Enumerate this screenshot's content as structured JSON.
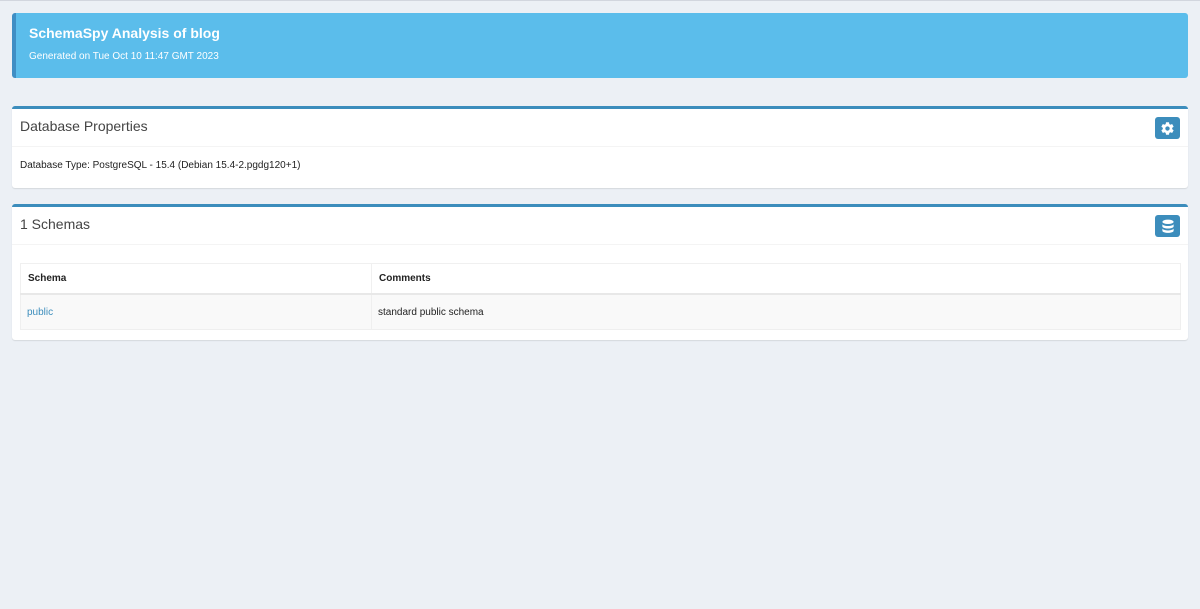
{
  "header": {
    "title": "SchemaSpy Analysis of blog",
    "generated": "Generated on Tue Oct 10 11:47 GMT 2023"
  },
  "database_properties": {
    "title": "Database Properties",
    "icon": "gear-icon",
    "database_type": "Database Type: PostgreSQL - 15.4 (Debian 15.4-2.pgdg120+1)"
  },
  "schemas": {
    "title": "1 Schemas",
    "icon": "database-icon",
    "columns": [
      "Schema",
      "Comments"
    ],
    "rows": [
      {
        "schema": "public",
        "comments": "standard public schema"
      }
    ]
  },
  "colors": {
    "callout": "#5bbdeb",
    "accent": "#3c8dbc",
    "background": "#ecf0f5"
  }
}
